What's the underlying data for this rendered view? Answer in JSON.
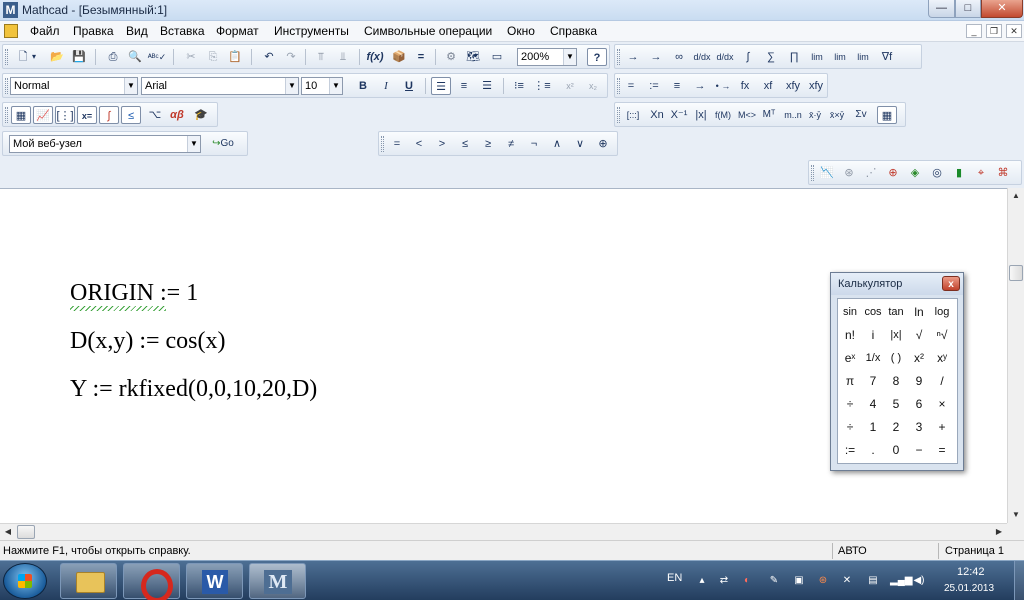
{
  "window": {
    "title": "Mathcad - [Безымянный:1]",
    "logo_letter": "M",
    "minimize": "—",
    "maximize": "□",
    "close": "✕"
  },
  "menu": {
    "items": [
      "Файл",
      "Правка",
      "Вид",
      "Вставка",
      "Формат",
      "Инструменты",
      "Символьные операции",
      "Окно",
      "Справка"
    ],
    "mdi_min": "_",
    "mdi_restore": "❐",
    "mdi_close": "✕"
  },
  "toolbar": {
    "standard": {
      "zoom": "200%",
      "buttons": [
        "new",
        "open",
        "save",
        "print",
        "print-preview",
        "spell-check",
        "cut",
        "copy",
        "paste",
        "undo",
        "redo",
        "align-horizontal",
        "align-vertical",
        "insert-function",
        "insert-unit",
        "calculate",
        "insert-component",
        "resources",
        "help"
      ],
      "function_label": "f(x)",
      "help_label": "?"
    },
    "symbolic_row": [
      "→",
      "→",
      "∞",
      "d/dx",
      "d/dx",
      "∫",
      "∑",
      "∏",
      "lim",
      "lim",
      "lim",
      "∇f"
    ],
    "formatting": {
      "style": "Normal",
      "font": "Arial",
      "size": "10",
      "bold": "B",
      "italic": "I",
      "underline": "U",
      "superscript": "x²",
      "subscript": "x₂"
    },
    "evaluation": [
      "=",
      ":=",
      "≡",
      "→",
      "• →",
      "fx",
      "xf",
      "xfy",
      "xfy"
    ],
    "math_palette": [
      "calculator",
      "graph",
      "matrix",
      "evaluation",
      "calculus",
      "boolean",
      "programming",
      "greek",
      "symbolic"
    ],
    "math_palette_labels": {
      "evaluation": "x=",
      "greek": "αβ"
    },
    "matrix_row": [
      "[:::]",
      "Xn",
      "X⁻¹",
      "|x|",
      "f(M)",
      "M<>",
      "Mᵀ",
      "m..n",
      "x̄·ȳ",
      "x̄×ȳ",
      "Σv",
      "▦"
    ],
    "resources": {
      "address": "Мой веб-узел",
      "go": "Go"
    },
    "boolean_row": [
      "=",
      "<",
      ">",
      "≤",
      "≥",
      "≠",
      "¬",
      "∧",
      "∨",
      "⊕"
    ],
    "graph_row": [
      "xy-plot",
      "polar-plot",
      "3d-surface",
      "contour",
      "3d-scatter",
      "3d-bar",
      "vector-field",
      "zoom",
      "trace"
    ]
  },
  "document": {
    "lines": [
      "ORIGIN := 1",
      "D(x,y) := cos(x)",
      "Y := rkfixed(0,0,10,20,D)"
    ]
  },
  "calculator": {
    "title": "Калькулятор",
    "close": "x",
    "rows": [
      [
        "sin",
        "cos",
        "tan",
        "ln",
        "log"
      ],
      [
        "n!",
        "i",
        "|x|",
        "√",
        "ⁿ√"
      ],
      [
        "eˣ",
        "1/x",
        "( )",
        "x²",
        "xʸ"
      ],
      [
        "π",
        "7",
        "8",
        "9",
        "/"
      ],
      [
        "÷",
        "4",
        "5",
        "6",
        "×"
      ],
      [
        "÷",
        "1",
        "2",
        "3",
        "+"
      ],
      [
        ":=",
        ".",
        "0",
        "−",
        "="
      ]
    ]
  },
  "status": {
    "help": "Нажмите F1, чтобы открыть справку.",
    "mode": "АВТО",
    "page": "Страница 1"
  },
  "taskbar": {
    "apps": [
      "explorer",
      "opera",
      "word",
      "mathcad"
    ],
    "language": "EN",
    "time": "12:42",
    "date": "25.01.2013"
  }
}
